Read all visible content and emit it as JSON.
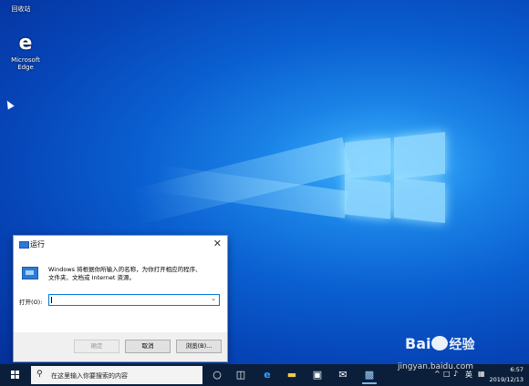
{
  "desktop": {
    "recycle_bin_label": "回收站",
    "edge_label_line1": "Microsoft",
    "edge_label_line2": "Edge"
  },
  "run_dialog": {
    "title": "运行",
    "close_icon": "✕",
    "description_line1": "Windows 将根据你所输入的名称，为你打开相应的程序、",
    "description_line2": "文件夹、文档或 Internet 资源。",
    "open_label": "打开(O):",
    "input_value": "",
    "ok_label": "确定",
    "cancel_label": "取消",
    "browse_label": "浏览(B)..."
  },
  "taskbar": {
    "search_placeholder": "在这里输入你要搜索的内容",
    "tray_lang": "英",
    "time": "6:57",
    "date": "2019/12/13"
  },
  "watermark": {
    "brand_left": "Bai",
    "brand_right": "经验",
    "url": "jingyan.baidu.com"
  },
  "colors": {
    "accent": "#0078d7",
    "taskbar": "#0b1f3a",
    "desktop_blue": "#0a5fd0"
  }
}
